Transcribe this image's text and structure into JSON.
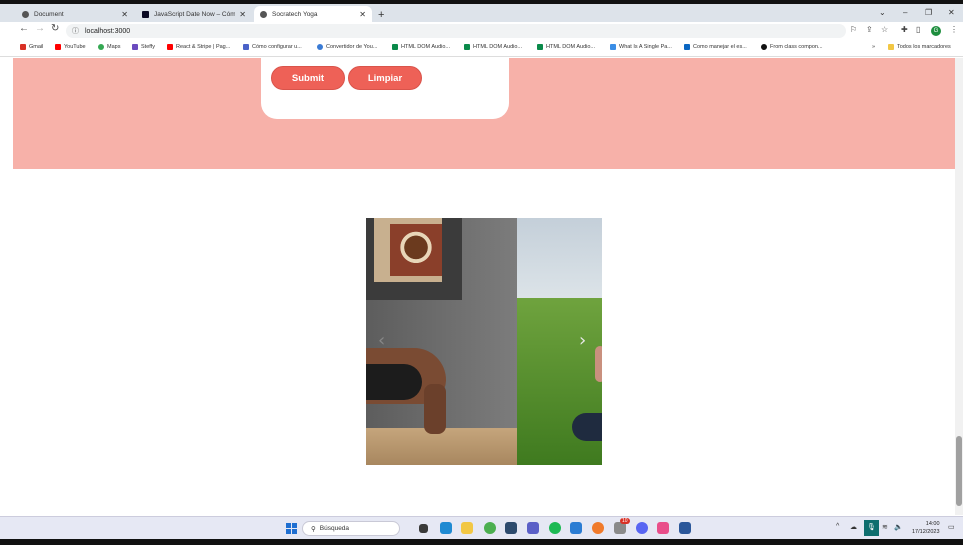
{
  "browser": {
    "tabs": [
      {
        "title": "Document"
      },
      {
        "title": "JavaScript Date Now – Cómo obte..."
      },
      {
        "title": "Socratech Yoga"
      }
    ],
    "address": "localhost:3000",
    "profile_initial": "G",
    "bookmarks": [
      {
        "label": "Gmail",
        "color": "#d93025"
      },
      {
        "label": "YouTube",
        "color": "#ff0000"
      },
      {
        "label": "Maps",
        "color": "#34a853"
      },
      {
        "label": "Steffy",
        "color": "#6b4bbf"
      },
      {
        "label": "React & Stripe | Pag...",
        "color": "#ff0000"
      },
      {
        "label": "Cómo configurar u...",
        "color": "#4a62c8"
      },
      {
        "label": "Convertidor de You...",
        "color": "#3a7bd5"
      },
      {
        "label": "HTML DOM Audio...",
        "color": "#0a8a4a"
      },
      {
        "label": "HTML DOM Audio...",
        "color": "#0a8a4a"
      },
      {
        "label": "HTML DOM Audio...",
        "color": "#0a8a4a"
      },
      {
        "label": "What Is A Single Pa...",
        "color": "#3a8ee6"
      },
      {
        "label": "Como manejar el es...",
        "color": "#0a66c2"
      },
      {
        "label": "From class compon...",
        "color": "#111111"
      }
    ],
    "all_bookmarks": "Todos los marcadores"
  },
  "page": {
    "submit_label": "Submit",
    "clear_label": "Limpiar",
    "accent_color": "#ee6157",
    "band_color": "#f7b1a9"
  },
  "taskbar": {
    "search_label": "Búsqueda",
    "time": "14:00",
    "date": "17/12/2023",
    "notification_count": "10"
  }
}
